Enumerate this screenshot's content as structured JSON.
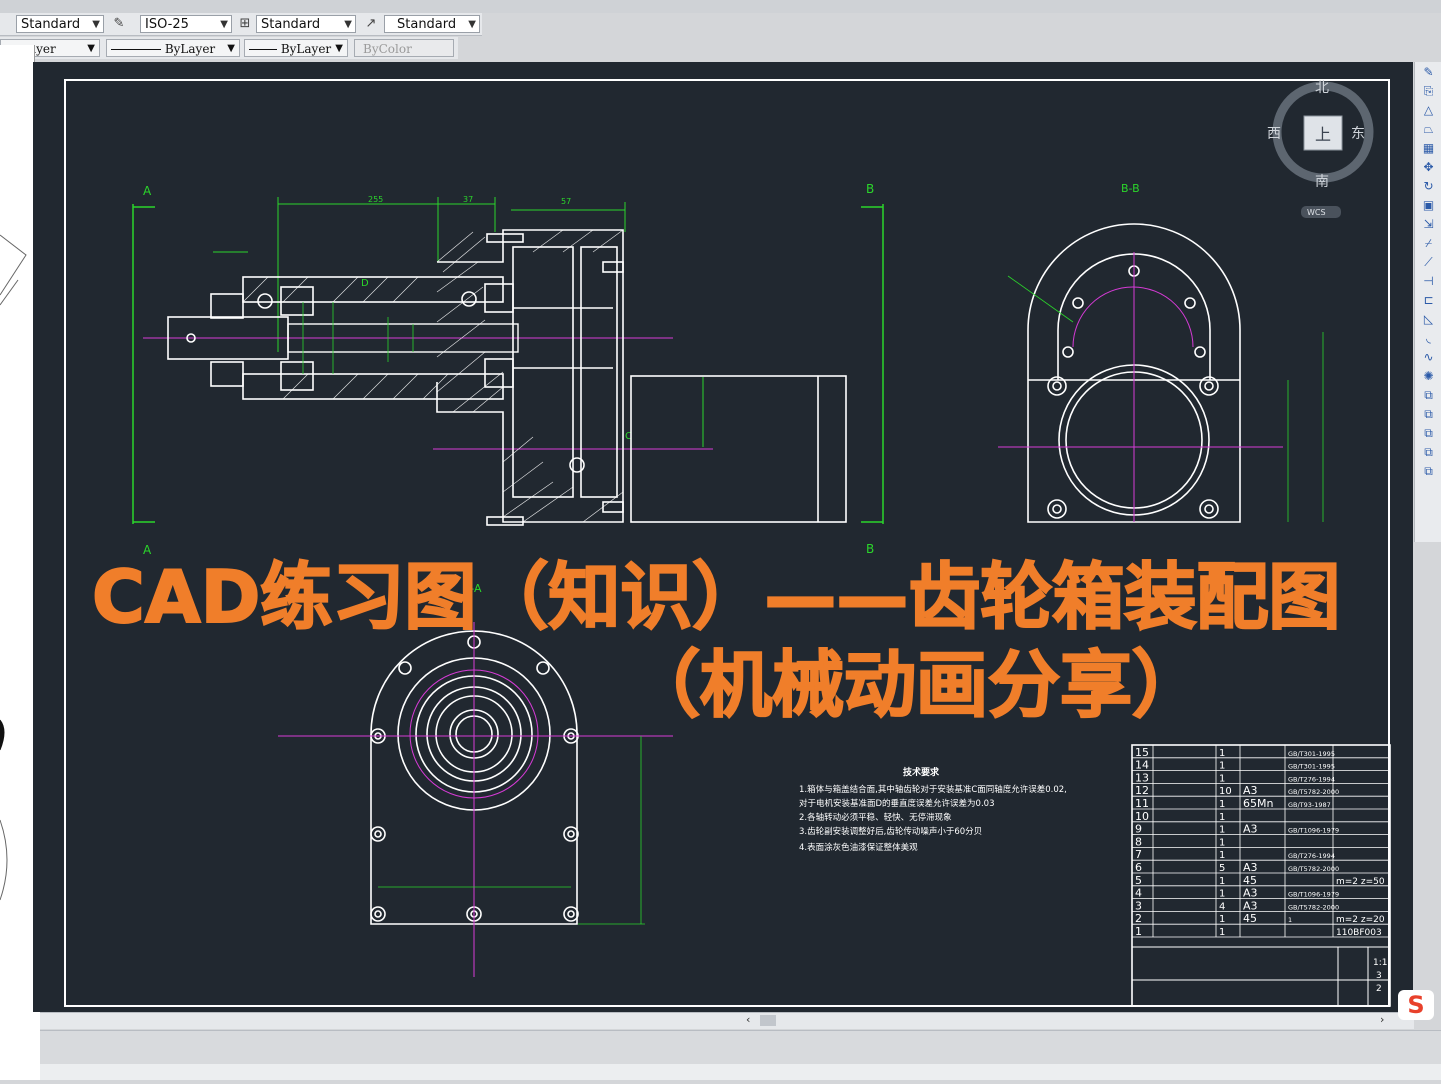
{
  "toolbar_styles": {
    "text_style": "Standard",
    "dim_style": "ISO-25",
    "table_style": "Standard",
    "mleader_style": "Standard"
  },
  "toolbar_props": {
    "layer": "ayer",
    "linetype": "ByLayer",
    "lineweight": "ByLayer",
    "color": "ByColor"
  },
  "nav_cube": {
    "north": "北",
    "south": "南",
    "east": "东",
    "west": "西",
    "face": "上",
    "wcs": "WCS"
  },
  "drawing": {
    "section_a": "A",
    "section_b": "B",
    "view_bb": "B-B",
    "view_aa": "A-A",
    "label_d": "D",
    "label_c": "C",
    "tech_title": "技术要求",
    "tech_notes": [
      "1.箱体与箱盖结合面,其中轴齿轮对于安装基准C面同轴度允许误差0.02,",
      "   对于电机安装基准面D的垂直度误差允许误差为0.03",
      "2.各轴转动必须平稳、轻快、无停滞现象",
      "3.齿轮副安装调整好后,齿轮传动噪声小于60分贝",
      "4.表面涂灰色油漆保证整体美观"
    ]
  },
  "bom": {
    "rows": [
      {
        "no": "15",
        "qty": "1",
        "mat": "",
        "std": "GB/T301-1995",
        "note": ""
      },
      {
        "no": "14",
        "qty": "1",
        "mat": "",
        "std": "GB/T301-1995",
        "note": ""
      },
      {
        "no": "13",
        "qty": "1",
        "mat": "",
        "std": "GB/T276-1994",
        "note": ""
      },
      {
        "no": "12",
        "qty": "10",
        "mat": "A3",
        "std": "GB/T5782-2000",
        "note": ""
      },
      {
        "no": "11",
        "qty": "1",
        "mat": "65Mn",
        "std": "GB/T93-1987",
        "note": ""
      },
      {
        "no": "10",
        "qty": "1",
        "mat": "",
        "std": "",
        "note": ""
      },
      {
        "no": "9",
        "qty": "1",
        "mat": "A3",
        "std": "GB/T1096-1979",
        "note": ""
      },
      {
        "no": "8",
        "qty": "1",
        "mat": "",
        "std": "",
        "note": ""
      },
      {
        "no": "7",
        "qty": "1",
        "mat": "",
        "std": "GB/T276-1994",
        "note": ""
      },
      {
        "no": "6",
        "qty": "5",
        "mat": "A3",
        "std": "GB/T5782-2000",
        "note": ""
      },
      {
        "no": "5",
        "qty": "1",
        "mat": "45",
        "std": "",
        "note": "m=2  z=50"
      },
      {
        "no": "4",
        "qty": "1",
        "mat": "A3",
        "std": "GB/T1096-1979",
        "note": ""
      },
      {
        "no": "3",
        "qty": "4",
        "mat": "A3",
        "std": "GB/T5782-2000",
        "note": ""
      },
      {
        "no": "2",
        "qty": "1",
        "mat": "45",
        "std": "1",
        "note": "m=2  z=20"
      },
      {
        "no": "1",
        "qty": "1",
        "mat": "",
        "std": "",
        "note": "110BF003"
      }
    ],
    "scale": "1:1",
    "sheet_qty_1": "3",
    "sheet_qty_2": "2"
  },
  "overlay_title": {
    "line1": "CAD练习图（知识）——齿轮箱装配图",
    "line2": "（机械动画分享）"
  },
  "colors": {
    "canvas": "#212830",
    "line_white": "#ffffff",
    "line_green": "#2bd52b",
    "line_magenta": "#d63bd6",
    "accent_orange": "#f07e2a"
  }
}
